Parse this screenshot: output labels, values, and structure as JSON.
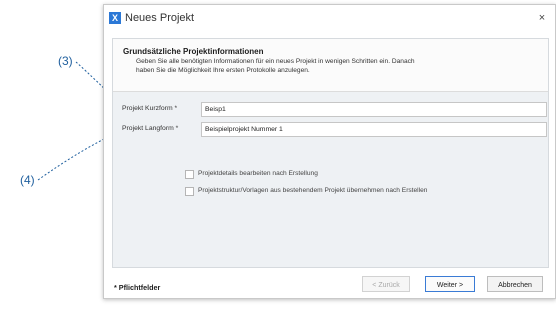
{
  "annotations": {
    "callout_3": "(3)",
    "callout_4": "(4)"
  },
  "dialog": {
    "title": "Neues Projekt",
    "close_glyph": "×",
    "icon_letter": "X"
  },
  "header": {
    "title": "Grundsätzliche Projektinformationen",
    "description_line1": "Geben Sie alle benötigten Informationen für ein neues Projekt in wenigen Schritten ein. Danach",
    "description_line2": "haben Sie die Möglichkeit Ihre ersten Protokolle anzulegen."
  },
  "fields": {
    "short_label": "Projekt Kurzform *",
    "short_value": "Beisp1",
    "long_label": "Projekt Langform *",
    "long_value": "Beispielprojekt Nummer 1"
  },
  "options": {
    "edit_details": "Projektdetails bearbeiten nach Erstellung",
    "copy_structure": "Projektstruktur/Vorlagen aus bestehendem Projekt übernehmen nach Erstellen"
  },
  "footer": {
    "required_note": "* Pflichtfelder",
    "back_label": "< Zurück",
    "next_label": "Weiter >",
    "cancel_label": "Abbrechen"
  },
  "colors": {
    "accent": "#2b78d6",
    "callout": "#1f5f9e"
  }
}
